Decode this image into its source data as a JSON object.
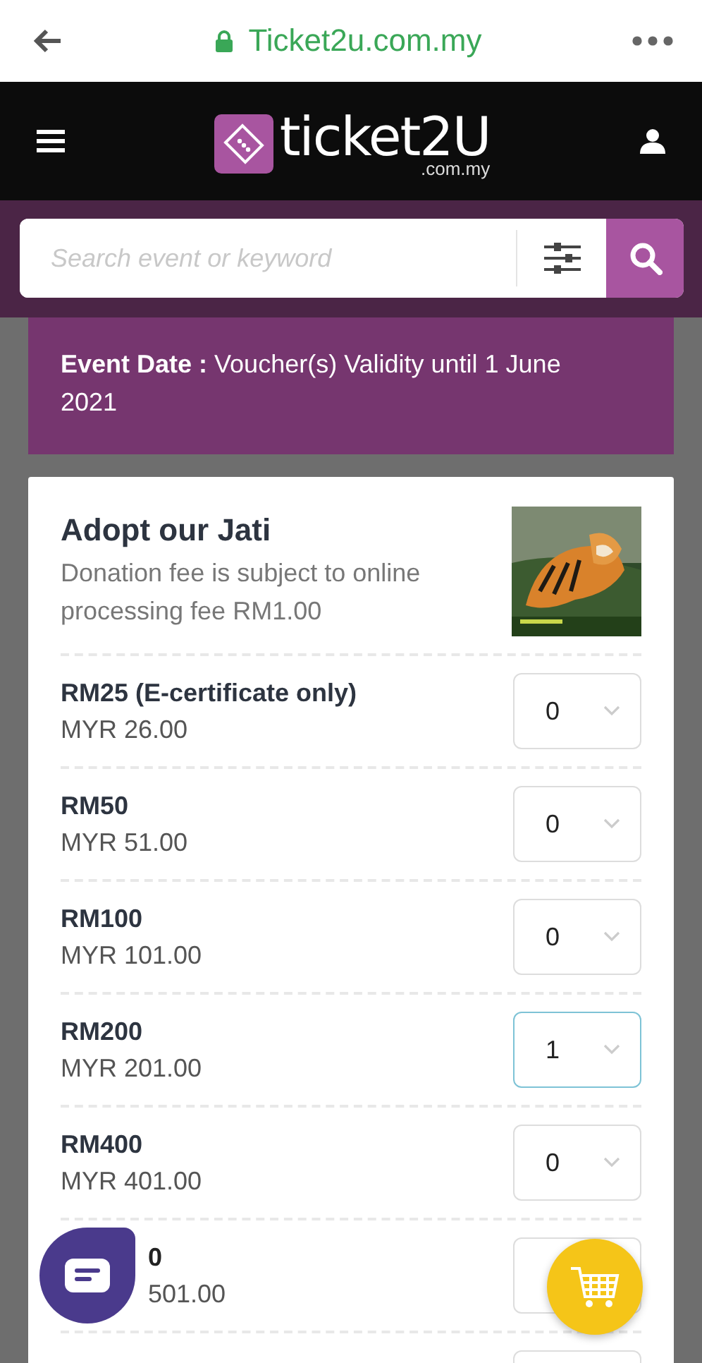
{
  "browser": {
    "url": "Ticket2u.com.my"
  },
  "header": {
    "logo_text": "ticket2U",
    "logo_sub": ".com.my"
  },
  "search": {
    "placeholder": "Search event or keyword"
  },
  "event_date": {
    "label": "Event Date :",
    "value": "Voucher(s) Validity until 1 June 2021"
  },
  "event": {
    "title": "Adopt our Jati",
    "note": "Donation fee is subject to online processing fee RM1.00"
  },
  "tickets": [
    {
      "kind": "full",
      "name": "RM25 (E-certificate only)",
      "price": "MYR 26.00",
      "qty": "0",
      "selected": false
    },
    {
      "kind": "full",
      "name": "RM50",
      "price": "MYR 51.00",
      "qty": "0",
      "selected": false
    },
    {
      "kind": "full",
      "name": "RM100",
      "price": "MYR 101.00",
      "qty": "0",
      "selected": false
    },
    {
      "kind": "full",
      "name": "RM200",
      "price": "MYR 201.00",
      "qty": "1",
      "selected": true
    },
    {
      "kind": "full",
      "name": "RM400",
      "price": "MYR 401.00",
      "qty": "0",
      "selected": false
    },
    {
      "kind": "covered",
      "name": "0",
      "price": "501.00",
      "selected": false
    },
    {
      "kind": "edge",
      "selected": false
    }
  ]
}
